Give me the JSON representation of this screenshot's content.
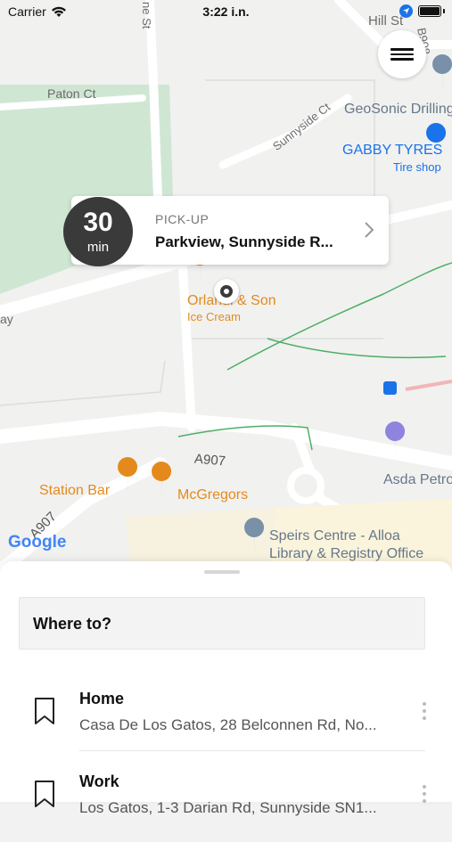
{
  "status_bar": {
    "carrier": "Carrier",
    "time": "3:22 i.n."
  },
  "map": {
    "labels": {
      "hill_st": "Hill St",
      "b908": "B908",
      "ne_st": "ne St",
      "paton_ct": "Paton Ct",
      "sunnyside_ct": "Sunnyside Ct",
      "geosonic": "GeoSonic Drilling",
      "gabby_tyres": "GABBY TYRES",
      "tire_shop": "Tire shop",
      "ay": "ay",
      "orlandi": "Orlandi & Son",
      "ice_cream": "Ice Cream",
      "a907_top": "A907",
      "a907_left": "A907",
      "station_bar": "Station Bar",
      "mcgregors": "McGregors",
      "asda": "Asda Petro",
      "speirs_1": "Speirs Centre - Alloa",
      "speirs_2": "Library & Registry Office",
      "google": "Google"
    },
    "colors": {
      "park": "#cfe6d3",
      "road": "#ffffff",
      "poi": "#e48a1c",
      "blue_poi": "#1a73e8",
      "path_green": "#4caf63"
    }
  },
  "pickup": {
    "eta_value": "30",
    "eta_unit": "min",
    "label": "PICK-UP",
    "address": "Parkview, Sunnyside R..."
  },
  "sheet": {
    "search_placeholder": "Where to?",
    "places": [
      {
        "name": "Home",
        "address": "Casa De Los Gatos, 28 Belconnen Rd, No...",
        "icon": "bookmark-icon"
      },
      {
        "name": "Work",
        "address": "Los Gatos, 1-3 Darian Rd, Sunnyside SN1...",
        "icon": "bookmark-icon"
      }
    ]
  }
}
